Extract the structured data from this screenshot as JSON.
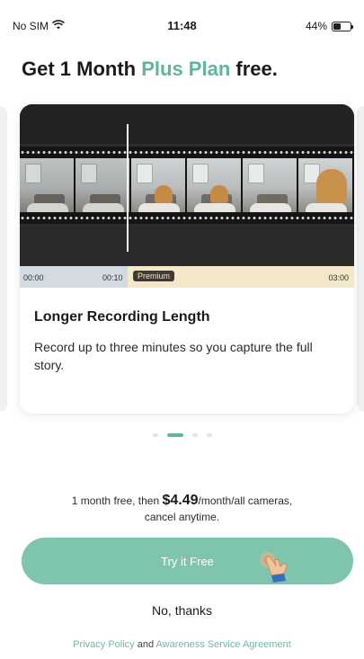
{
  "status_bar": {
    "carrier": "No SIM",
    "time": "11:48",
    "battery_percent": "44%",
    "battery_level": 0.44,
    "wifi_icon": "wifi-icon"
  },
  "headline": {
    "prefix": "Get 1 Month ",
    "accent": "Plus Plan",
    "suffix": " free.",
    "accent_color": "#5fb69a"
  },
  "card": {
    "timeline": {
      "start": "00:00",
      "free_end": "00:10",
      "premium_label": "Premium",
      "end": "03:00"
    },
    "title": "Longer Recording Length",
    "description": "Record up to three minutes so you capture the full story."
  },
  "pager": {
    "count": 4,
    "active_index": 1
  },
  "pricing": {
    "prefix": "1 month free, then ",
    "amount": "$4.49",
    "suffix": "/month/all cameras,",
    "line2": "cancel anytime."
  },
  "cta": {
    "try_label": "Try it Free",
    "try_color": "#7fc4ad",
    "no_thanks_label": "No, thanks"
  },
  "footer": {
    "privacy_label": "Privacy Policy",
    "and_label": " and ",
    "agreement_label": "Awareness Service Agreement"
  }
}
